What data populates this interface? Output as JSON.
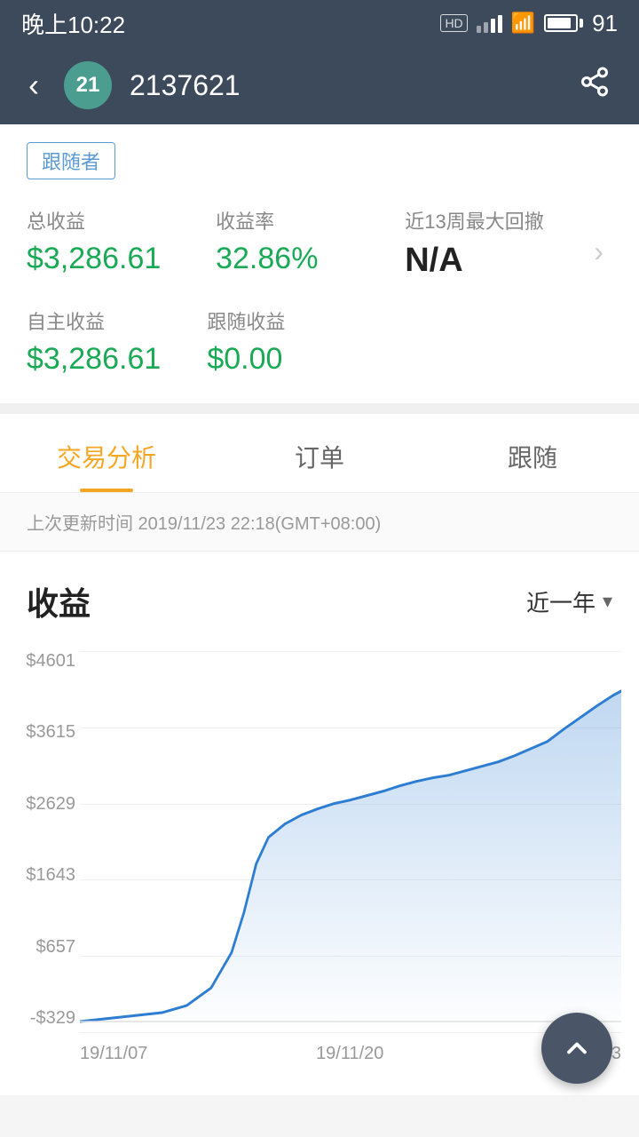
{
  "statusBar": {
    "time": "晚上10:22",
    "battery": "91"
  },
  "header": {
    "backLabel": "‹",
    "avatarText": "21",
    "username": "2137621",
    "shareLabel": "⤴"
  },
  "followerTag": "跟随者",
  "stats": {
    "totalProfit": {
      "label": "总收益",
      "value": "$3,286.61"
    },
    "profitRate": {
      "label": "收益率",
      "value": "32.86%"
    },
    "maxDrawdown": {
      "label": "近13周最大回撤",
      "value": "N/A"
    },
    "selfProfit": {
      "label": "自主收益",
      "value": "$3,286.61"
    },
    "followProfit": {
      "label": "跟随收益",
      "value": "$0.00"
    }
  },
  "tabs": [
    {
      "label": "交易分析",
      "active": true
    },
    {
      "label": "订单",
      "active": false
    },
    {
      "label": "跟随",
      "active": false
    }
  ],
  "updateTime": "上次更新时间 2019/11/23 22:18(GMT+08:00)",
  "chart": {
    "title": "收益",
    "period": "近一年",
    "yLabels": [
      "$4601",
      "$3615",
      "$2629",
      "$1643",
      "$657",
      "-$329"
    ],
    "xLabels": [
      "19/11/07",
      "19/11/20",
      "19/12/03"
    ],
    "dataPoints": [
      [
        0,
        430
      ],
      [
        30,
        428
      ],
      [
        60,
        425
      ],
      [
        80,
        422
      ],
      [
        100,
        418
      ],
      [
        130,
        415
      ],
      [
        160,
        400
      ],
      [
        190,
        370
      ],
      [
        210,
        310
      ],
      [
        230,
        240
      ],
      [
        250,
        210
      ],
      [
        270,
        180
      ],
      [
        290,
        165
      ],
      [
        310,
        155
      ],
      [
        330,
        148
      ],
      [
        350,
        142
      ],
      [
        370,
        138
      ],
      [
        390,
        130
      ],
      [
        410,
        122
      ],
      [
        430,
        118
      ],
      [
        450,
        112
      ],
      [
        480,
        108
      ],
      [
        510,
        102
      ],
      [
        530,
        96
      ],
      [
        550,
        90
      ],
      [
        570,
        80
      ],
      [
        590,
        72
      ],
      [
        610,
        62
      ],
      [
        630,
        50
      ],
      [
        640,
        42
      ]
    ]
  },
  "fab": {
    "label": "↑"
  }
}
